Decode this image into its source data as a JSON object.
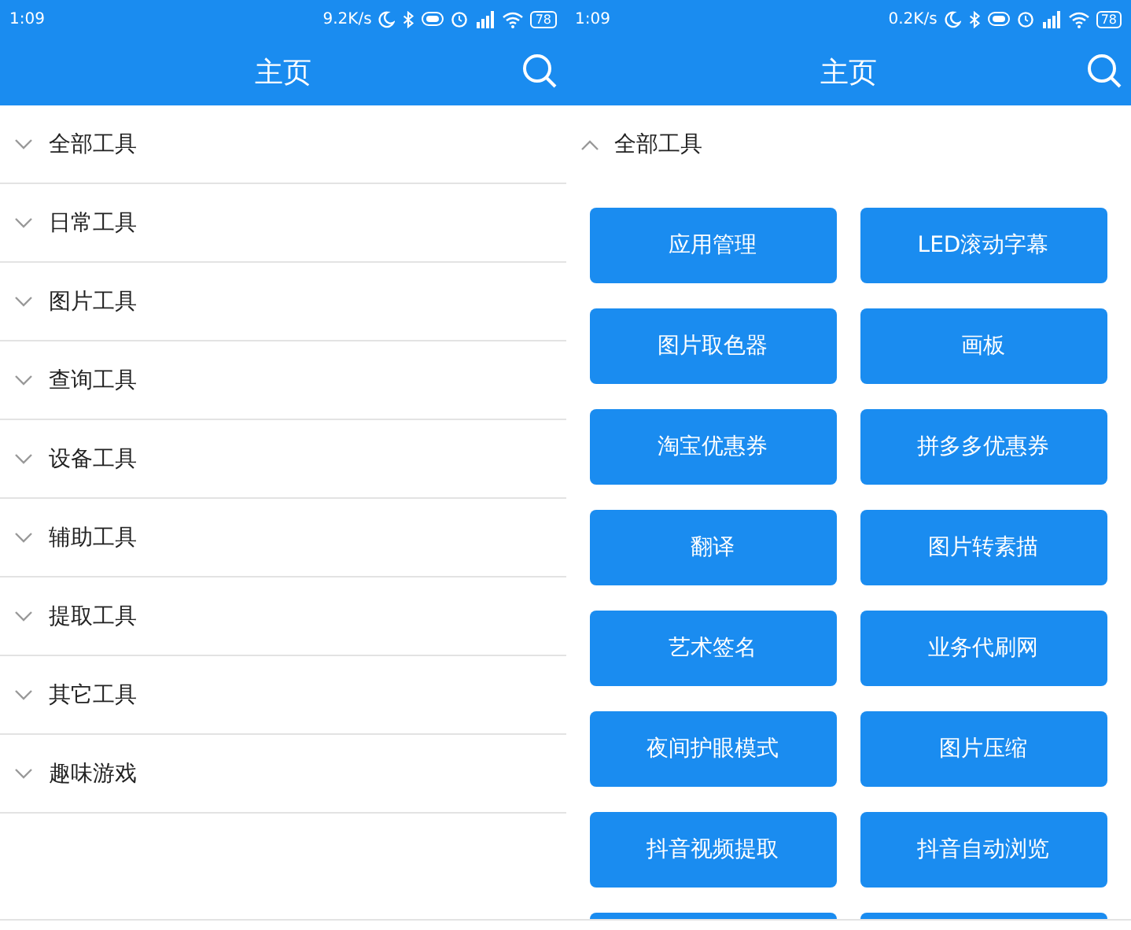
{
  "screens": [
    {
      "status_bar": {
        "time": "1:09",
        "net_speed": "9.2K/s",
        "battery": "78"
      },
      "title": "主页",
      "categories": [
        {
          "label": "全部工具",
          "expanded": false
        },
        {
          "label": "日常工具",
          "expanded": false
        },
        {
          "label": "图片工具",
          "expanded": false
        },
        {
          "label": "查询工具",
          "expanded": false
        },
        {
          "label": "设备工具",
          "expanded": false
        },
        {
          "label": "辅助工具",
          "expanded": false
        },
        {
          "label": "提取工具",
          "expanded": false
        },
        {
          "label": "其它工具",
          "expanded": false
        },
        {
          "label": "趣味游戏",
          "expanded": false
        }
      ]
    },
    {
      "status_bar": {
        "time": "1:09",
        "net_speed": "0.2K/s",
        "battery": "78"
      },
      "title": "主页",
      "categories": [
        {
          "label": "全部工具",
          "expanded": true,
          "tools": [
            {
              "kind": "button",
              "label": "应用管理"
            },
            {
              "kind": "button",
              "label": "LED滚动字幕"
            },
            {
              "kind": "button",
              "label": "图片取色器"
            },
            {
              "kind": "button",
              "label": "画板"
            },
            {
              "kind": "button",
              "label": "淘宝优惠券"
            },
            {
              "kind": "button",
              "label": "拼多多优惠券"
            },
            {
              "kind": "button",
              "label": "翻译"
            },
            {
              "kind": "button",
              "label": "图片转素描"
            },
            {
              "kind": "button",
              "label": "艺术签名"
            },
            {
              "kind": "button",
              "label": "业务代刷网"
            },
            {
              "kind": "button",
              "label": "夜间护眼模式"
            },
            {
              "kind": "button",
              "label": "图片压缩"
            },
            {
              "kind": "button",
              "label": "抖音视频提取"
            },
            {
              "kind": "button",
              "label": "抖音自动浏览"
            },
            {
              "kind": "cut"
            },
            {
              "kind": "cut"
            }
          ]
        }
      ]
    }
  ]
}
